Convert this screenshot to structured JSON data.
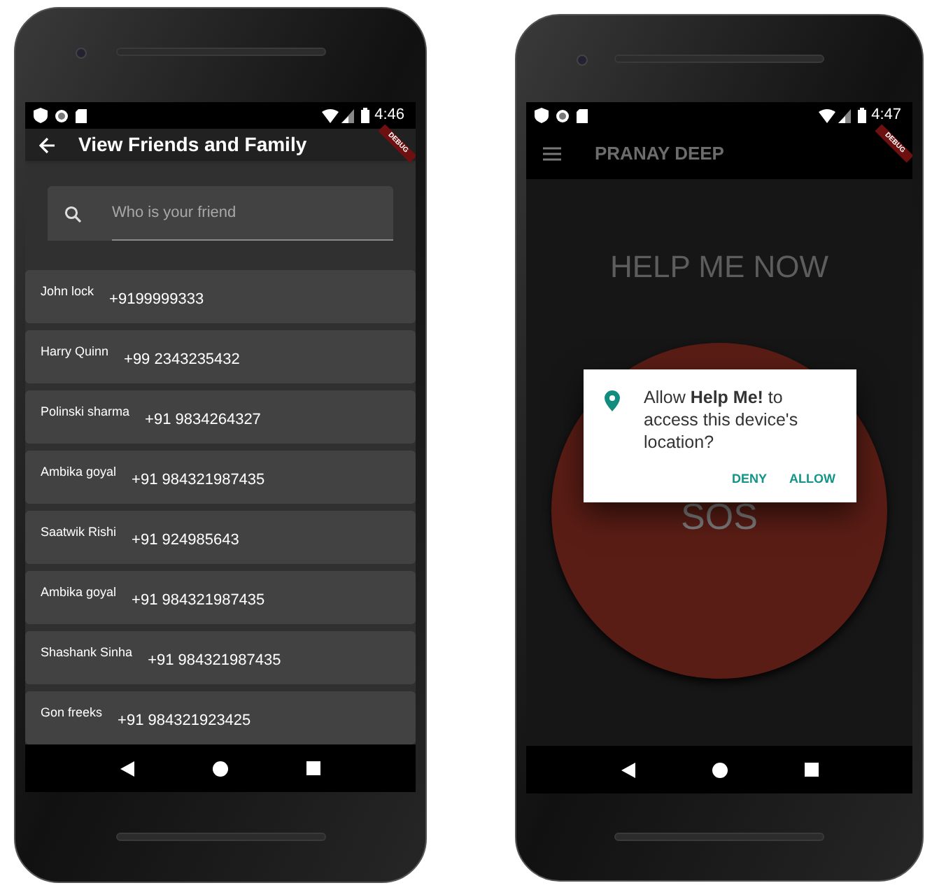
{
  "phones": [
    {
      "kind": "contacts",
      "status_bar": {
        "time": "4:46"
      },
      "debug_banner": "DEBUG",
      "app_bar": {
        "title": "View Friends and Family"
      },
      "search": {
        "placeholder": "Who is your friend"
      },
      "contacts": [
        {
          "name": "John lock",
          "phone": "+9199999333"
        },
        {
          "name": "Harry Quinn",
          "phone": "+99 2343235432"
        },
        {
          "name": "Polinski sharma",
          "phone": "+91 9834264327"
        },
        {
          "name": "Ambika goyal",
          "phone": "+91 984321987435"
        },
        {
          "name": "Saatwik Rishi",
          "phone": "+91 924985643"
        },
        {
          "name": "Ambika goyal",
          "phone": "+91 984321987435"
        },
        {
          "name": "Shashank Sinha",
          "phone": "+91 984321987435"
        },
        {
          "name": "Gon freeks",
          "phone": "+91 984321923425"
        }
      ]
    },
    {
      "kind": "sos",
      "status_bar": {
        "time": "4:47"
      },
      "debug_banner": "DEBUG",
      "app_bar": {
        "title": "PRANAY DEEP"
      },
      "heading": "HELP ME NOW",
      "sos_button": "SOS",
      "dialog": {
        "message": "Allow **Help Me!** to access this device's location?",
        "buttons": [
          "DENY",
          "ALLOW"
        ]
      }
    }
  ]
}
